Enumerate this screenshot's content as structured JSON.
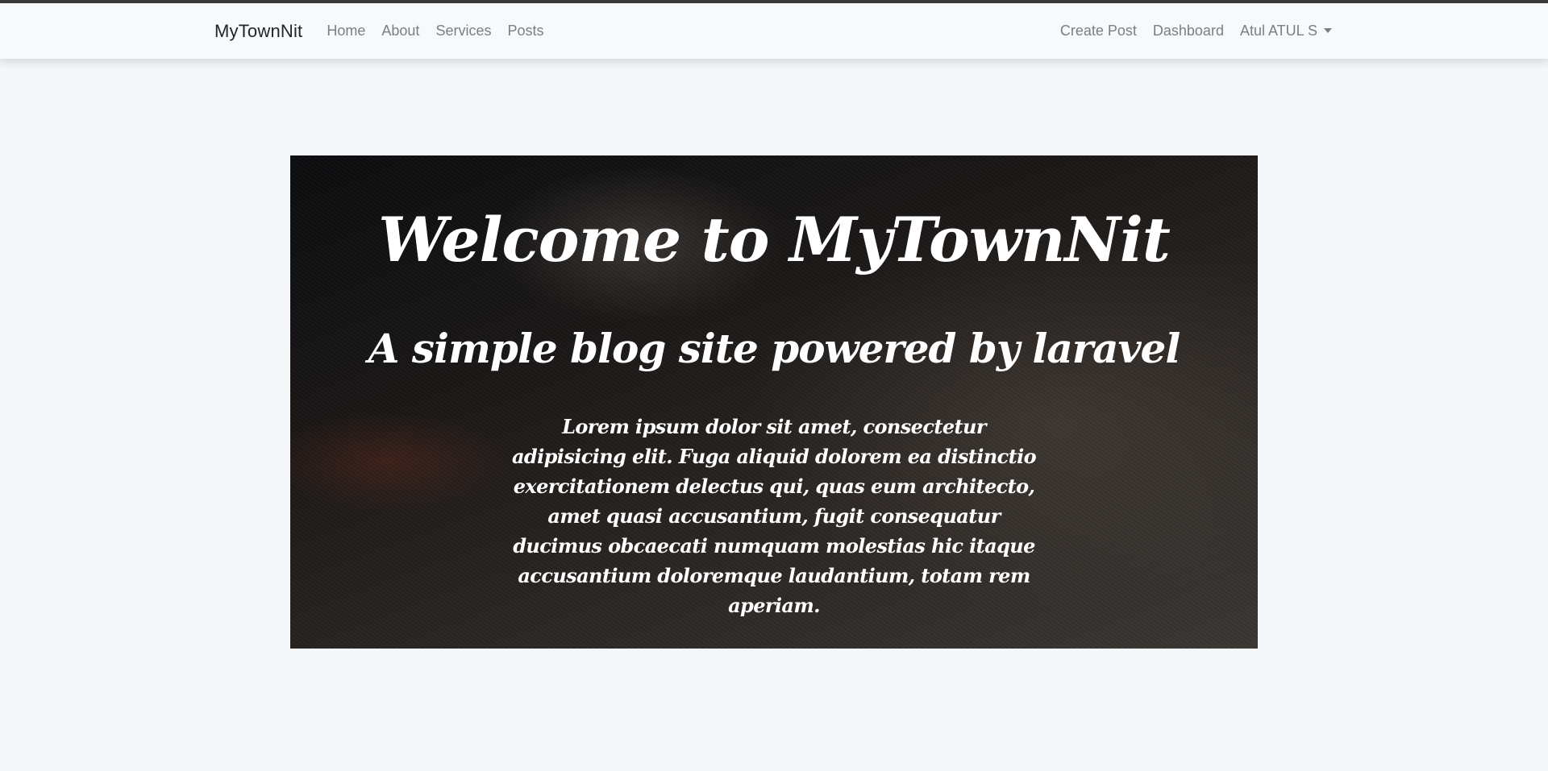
{
  "navbar": {
    "brand": "MyTownNit",
    "left_links": [
      "Home",
      "About",
      "Services",
      "Posts"
    ],
    "right_links": [
      "Create Post",
      "Dashboard"
    ],
    "user_menu": "Atul ATUL S"
  },
  "hero": {
    "title": "Welcome to MyTownNit",
    "subtitle": "A simple blog site powered by laravel",
    "text": "Lorem ipsum dolor sit amet, consectetur adipisicing elit. Fuga aliquid dolorem ea distinctio exercitationem delectus qui, quas eum architecto, amet quasi accusantium, fugit consequatur ducimus obcaecati numquam molestias hic itaque accusantium doloremque laudantium, totam rem aperiam."
  }
}
